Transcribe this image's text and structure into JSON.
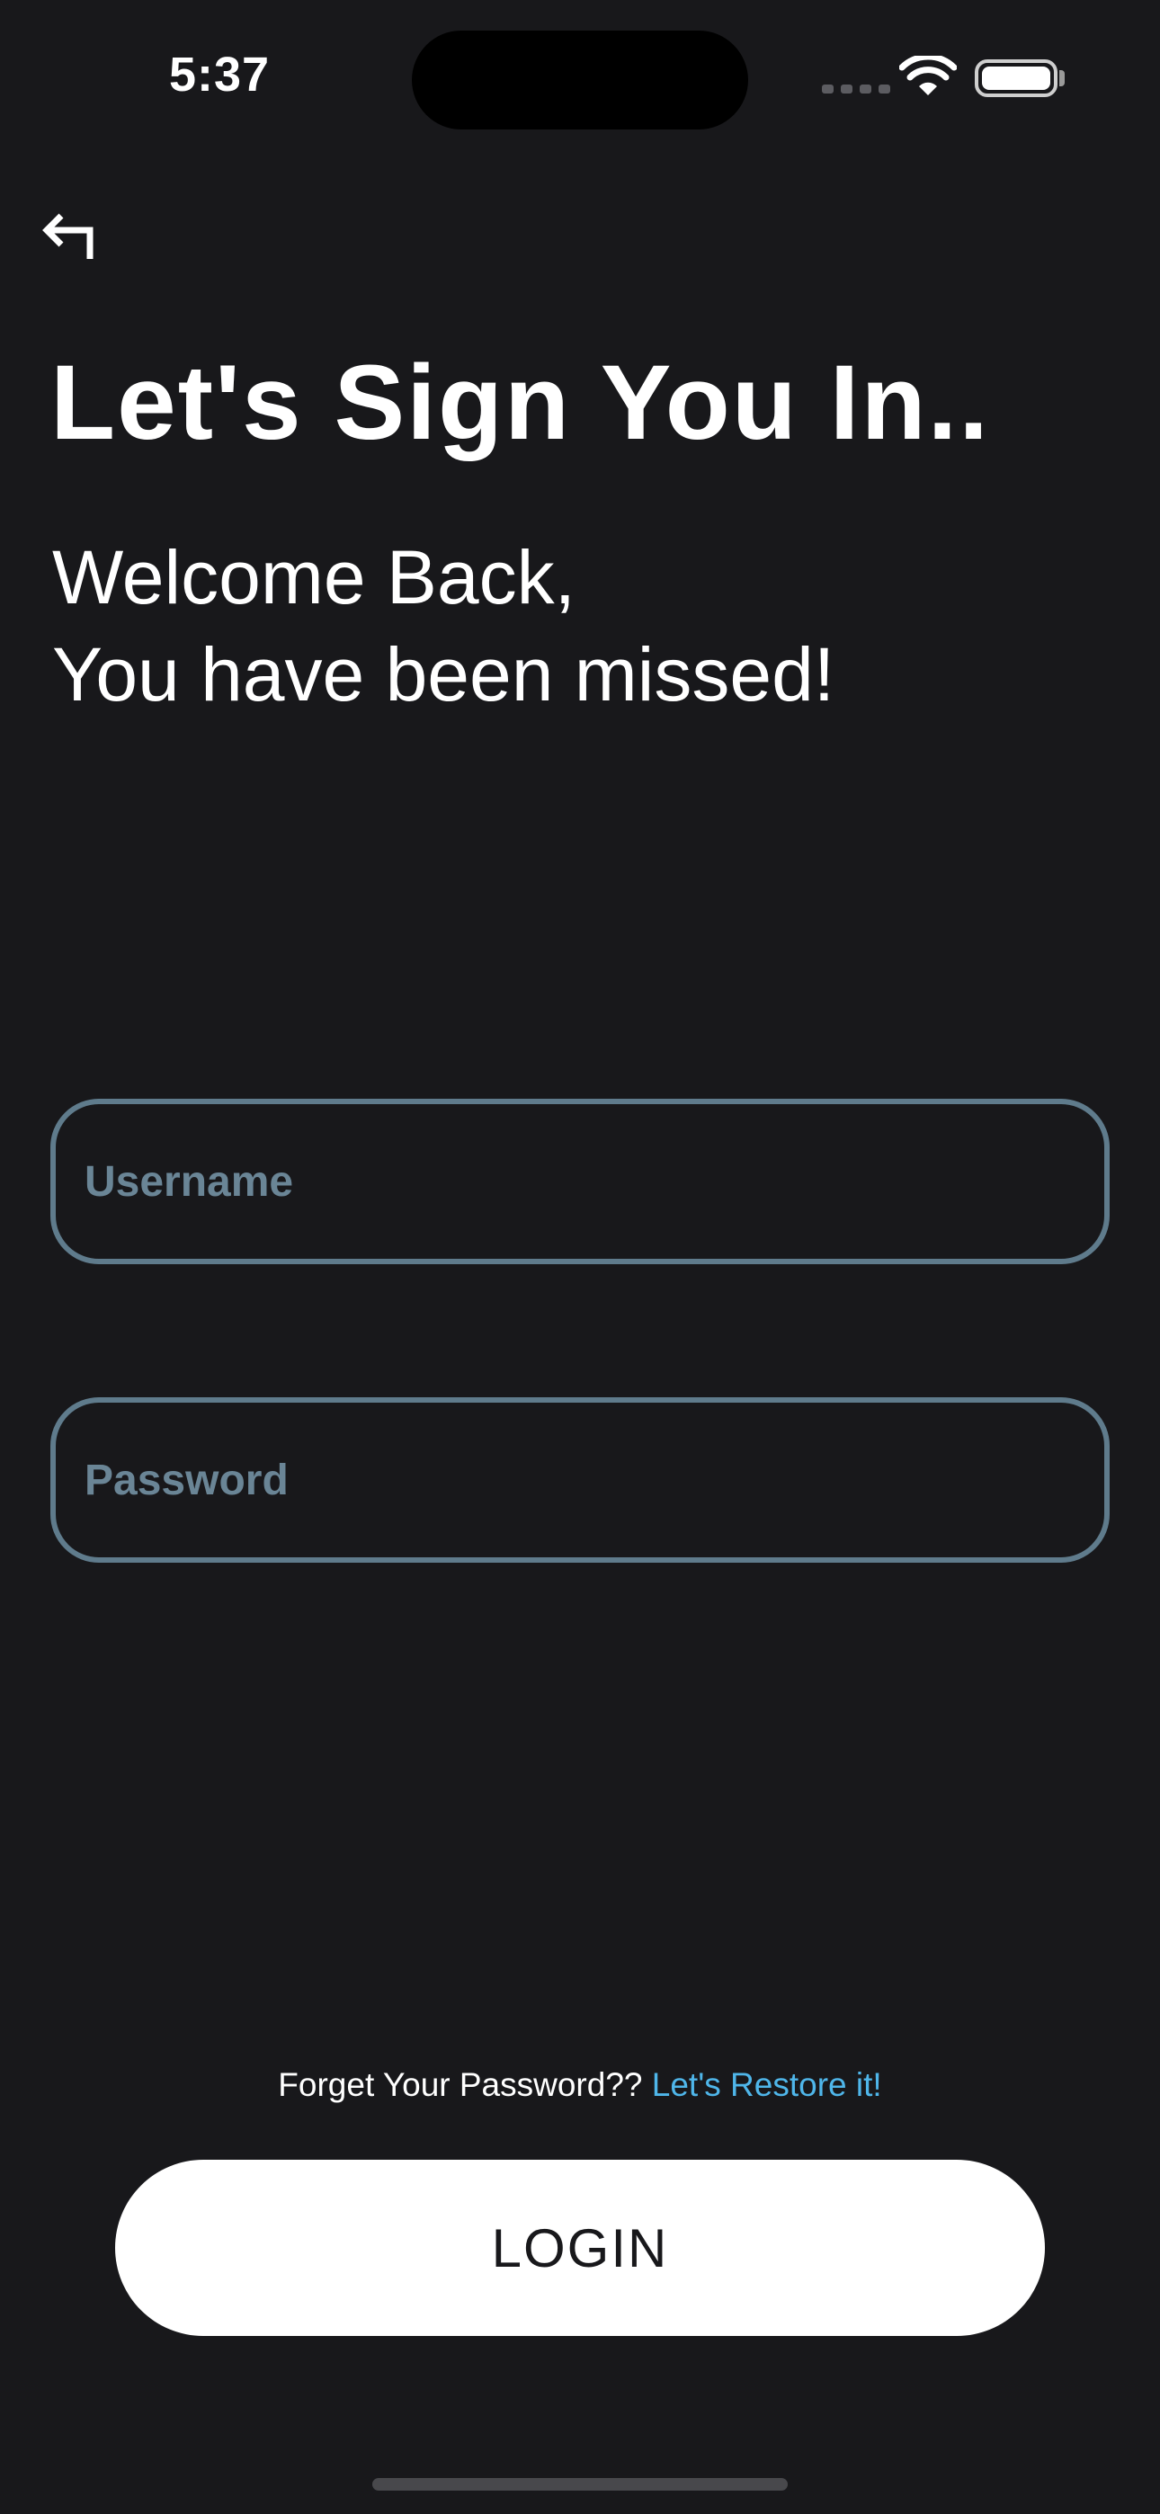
{
  "status_bar": {
    "time": "5:37"
  },
  "icons": {
    "back": "back-arrow-icon",
    "wifi": "wifi-icon",
    "battery": "battery-icon",
    "signal": "cellular-signal-icon"
  },
  "header": {
    "title": "Let's Sign You In..",
    "subtitle_line1": "Welcome Back,",
    "subtitle_line2": "You have been missed!"
  },
  "form": {
    "username_placeholder": "Username",
    "password_placeholder": "Password"
  },
  "forgot": {
    "text": "Forget Your Password??",
    "link": "Let's Restore it!"
  },
  "login_button": "LOGIN",
  "colors": {
    "background": "#18181b",
    "input_border": "#5f7b8c",
    "link": "#4fb6ea",
    "button_bg": "#ffffff"
  }
}
